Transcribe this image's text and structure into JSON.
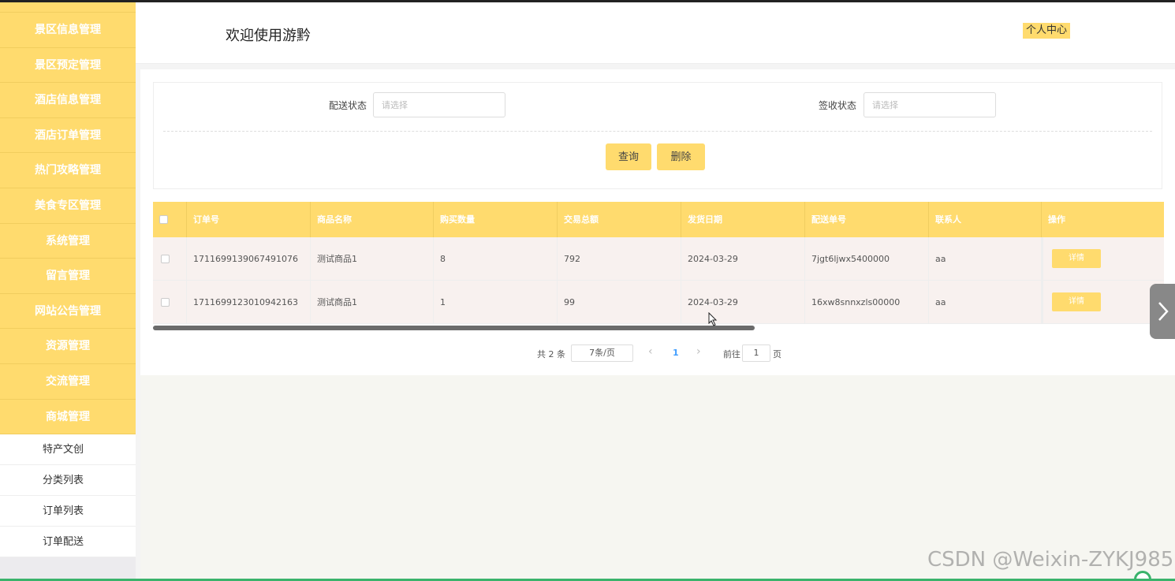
{
  "sidebar": {
    "items": [
      {
        "label": ""
      },
      {
        "label": "景区信息管理"
      },
      {
        "label": "景区预定管理"
      },
      {
        "label": "酒店信息管理"
      },
      {
        "label": "酒店订单管理"
      },
      {
        "label": "热门攻略管理"
      },
      {
        "label": "美食专区管理"
      },
      {
        "label": "系统管理"
      },
      {
        "label": "留言管理"
      },
      {
        "label": "网站公告管理"
      },
      {
        "label": "资源管理"
      },
      {
        "label": "交流管理"
      },
      {
        "label": "商城管理"
      }
    ],
    "submenu": [
      {
        "label": "特产文创"
      },
      {
        "label": "分类列表"
      },
      {
        "label": "订单列表"
      },
      {
        "label": "订单配送"
      }
    ]
  },
  "header": {
    "welcome": "欢迎使用游黔",
    "profile": "个人中心"
  },
  "search": {
    "delivery_label": "配送状态",
    "delivery_placeholder": "请选择",
    "receipt_label": "签收状态",
    "receipt_placeholder": "请选择",
    "query_button": "查询",
    "delete_button": "删除"
  },
  "table": {
    "columns": [
      "订单号",
      "商品名称",
      "购买数量",
      "交易总额",
      "发货日期",
      "配送单号",
      "联系人",
      "操作"
    ],
    "rows": [
      {
        "order_no": "1711699139067491076",
        "product": "测试商品1",
        "qty": "8",
        "total": "792",
        "ship_date": "2024-03-29",
        "delivery_no": "7jgt6ljwx5400000",
        "contact": "aa",
        "action": "详情"
      },
      {
        "order_no": "1711699123010942163",
        "product": "测试商品1",
        "qty": "1",
        "total": "99",
        "ship_date": "2024-03-29",
        "delivery_no": "16xw8snnxzls00000",
        "contact": "aa",
        "action": "详情"
      }
    ]
  },
  "pagination": {
    "total": "共 2 条",
    "page_size": "7条/页",
    "prev": "‹",
    "current": "1",
    "next": "›",
    "goto_label": "前往",
    "goto_value": "1",
    "page_suffix": "页"
  },
  "watermark": "CSDN @Weixin-ZYKJ985",
  "colors": {
    "accent": "#ffdb6e",
    "row_bg": "#f8f1ef"
  }
}
